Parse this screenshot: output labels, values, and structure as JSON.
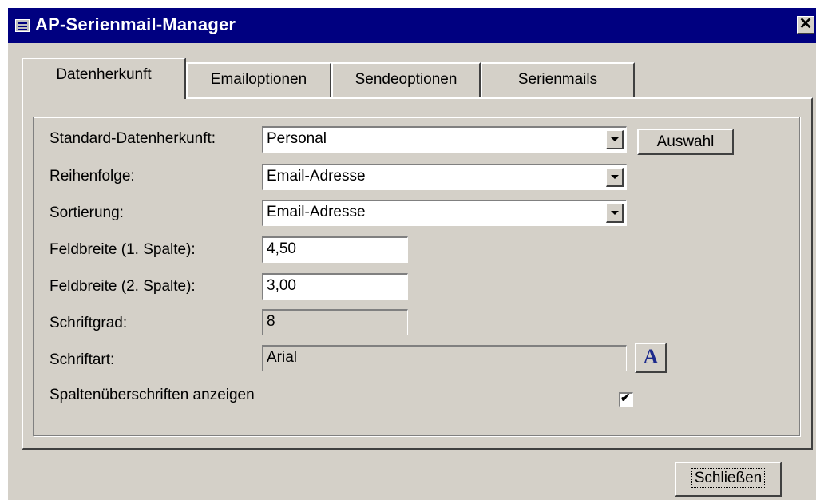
{
  "window": {
    "title": "AP-Serienmail-Manager",
    "close_glyph": "✕"
  },
  "tabs": [
    {
      "label": "Datenherkunft",
      "active": true
    },
    {
      "label": "Emailoptionen",
      "active": false
    },
    {
      "label": "Sendeoptionen",
      "active": false
    },
    {
      "label": "Serienmails",
      "active": false
    }
  ],
  "form": {
    "standard_datenherkunft": {
      "label": "Standard-Datenherkunft:",
      "value": "Personal"
    },
    "auswahl_button": "Auswahl",
    "reihenfolge": {
      "label": "Reihenfolge:",
      "value": "Email-Adresse"
    },
    "sortierung": {
      "label": "Sortierung:",
      "value": "Email-Adresse"
    },
    "feldbreite1": {
      "label": "Feldbreite (1. Spalte):",
      "value": "4,50"
    },
    "feldbreite2": {
      "label": "Feldbreite (2. Spalte):",
      "value": "3,00"
    },
    "schriftgrad": {
      "label": "Schriftgrad:",
      "value": "8"
    },
    "schriftart": {
      "label": "Schriftart:",
      "value": "Arial",
      "font_button_glyph": "A"
    },
    "spaltenueberschriften": {
      "label": "Spaltenüberschriften anzeigen",
      "checked": true,
      "check_glyph": "✔"
    }
  },
  "footer": {
    "close_button": "Schließen"
  },
  "colors": {
    "titlebar": "#000080",
    "face": "#d4d0c8",
    "font_button_glyph": "#1c2a8c"
  }
}
